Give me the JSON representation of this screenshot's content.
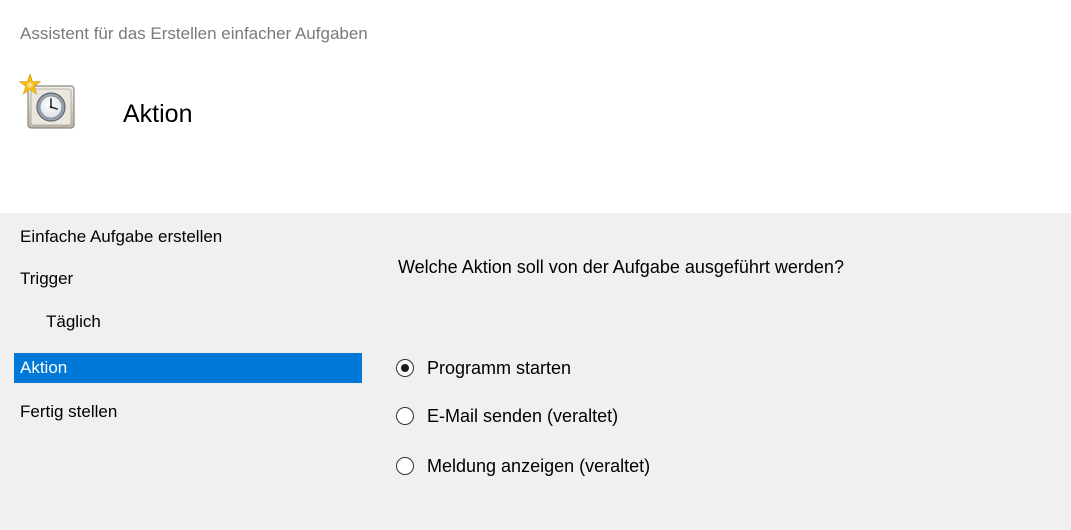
{
  "window": {
    "title": "Assistent für das Erstellen einfacher Aufgaben"
  },
  "header": {
    "icon": "task-scheduler-clock-icon",
    "title": "Aktion"
  },
  "sidebar": {
    "items": [
      {
        "label": "Einfache Aufgabe erstellen",
        "active": false,
        "indent": false
      },
      {
        "label": "Trigger",
        "active": false,
        "indent": false
      },
      {
        "label": "Täglich",
        "active": false,
        "indent": true
      },
      {
        "label": "Aktion",
        "active": true,
        "indent": false
      },
      {
        "label": "Fertig stellen",
        "active": false,
        "indent": false
      }
    ]
  },
  "main": {
    "question": "Welche Aktion soll von der Aufgabe ausgeführt werden?",
    "options": [
      {
        "label": "Programm starten",
        "checked": true
      },
      {
        "label": "E-Mail senden (veraltet)",
        "checked": false
      },
      {
        "label": "Meldung anzeigen (veraltet)",
        "checked": false
      }
    ]
  },
  "colors": {
    "selection": "#0078d7",
    "panel_background": "#f0f0f0",
    "header_background": "#ffffff",
    "title_gray": "#7a7a7a"
  }
}
